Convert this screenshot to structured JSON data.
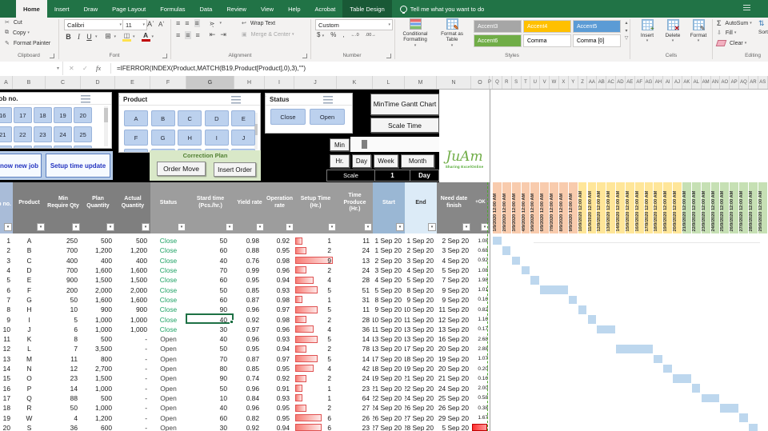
{
  "colors": {
    "excel_green": "#217346",
    "slicer_blue": "#bcd1ee",
    "gantt_bar": "#bdd7ee",
    "date_early": "#f8cbad",
    "date_mid": "#ffe699",
    "date_late": "#c6e0b4",
    "status_close_green": "#21a366",
    "databar_red": "#e05252",
    "header_gray": "#7f7f7f"
  },
  "ribbon": {
    "tabs": [
      {
        "label": "Home",
        "state": "active"
      },
      {
        "label": "Insert"
      },
      {
        "label": "Draw"
      },
      {
        "label": "Page Layout"
      },
      {
        "label": "Formulas"
      },
      {
        "label": "Data"
      },
      {
        "label": "Review"
      },
      {
        "label": "View"
      },
      {
        "label": "Help"
      },
      {
        "label": "Acrobat"
      },
      {
        "label": "Table Design",
        "state": "contextual"
      }
    ],
    "tell_me": "Tell me what you want to do",
    "clipboard": {
      "label": "Clipboard",
      "items": [
        "Cut",
        "Copy",
        "Format Painter"
      ]
    },
    "font": {
      "label": "Font",
      "font_name": "Calibri",
      "font_size": "11"
    },
    "alignment": {
      "label": "Alignment",
      "wrap_text": "Wrap Text",
      "merge_center": "Merge & Center"
    },
    "number": {
      "label": "Number",
      "format": "Custom"
    },
    "styles": {
      "label": "Styles",
      "cond_fmt": "Conditional Formatting",
      "fmt_table": "Format as Table",
      "gallery": [
        {
          "label": "Accent3",
          "bg": "#a6a6a6",
          "fg": "#ffffff"
        },
        {
          "label": "Accent4",
          "bg": "#ffc000",
          "fg": "#ffffff"
        },
        {
          "label": "Accent5",
          "bg": "#5b9bd5",
          "fg": "#ffffff"
        },
        {
          "label": "Accent6",
          "bg": "#70ad47",
          "fg": "#ffffff"
        },
        {
          "label": "Comma",
          "bg": "#ffffff",
          "fg": "#000000"
        },
        {
          "label": "Comma [0]",
          "bg": "#ffffff",
          "fg": "#000000"
        }
      ]
    },
    "cells": {
      "label": "Cells",
      "items": [
        "Insert",
        "Delete",
        "Format"
      ]
    },
    "editing": {
      "label": "Editing",
      "items": [
        "AutoSum",
        "Fill",
        "Clear"
      ],
      "sort_filter": "Sort & Filter"
    }
  },
  "formula_bar": {
    "formula": "=IFERROR(INDEX(Product,MATCH(B19,Product[Product],0),3),\"\")"
  },
  "column_letters": {
    "table": [
      "A",
      "B",
      "C",
      "D",
      "E",
      "F",
      "G",
      "H",
      "I",
      "J",
      "K",
      "L",
      "M",
      "N",
      "O"
    ],
    "selected": "G",
    "gantt": [
      "P",
      "Q",
      "R",
      "S",
      "T",
      "U",
      "V",
      "W",
      "X",
      "Y",
      "Z",
      "AA",
      "AB",
      "AC",
      "AD",
      "AE",
      "AF",
      "AG",
      "AH",
      "AI",
      "AJ",
      "AK",
      "AL",
      "AM",
      "AN",
      "AO",
      "AP",
      "AQ",
      "AR",
      "AS"
    ]
  },
  "slicers": {
    "job_no": {
      "title": "Job no.",
      "buttons": [
        "16",
        "17",
        "18",
        "19",
        "20",
        "21",
        "22",
        "23",
        "24",
        "25"
      ]
    },
    "product": {
      "title": "Product",
      "buttons": [
        "A",
        "B",
        "C",
        "D",
        "E",
        "F",
        "G",
        "H",
        "I",
        "J"
      ]
    },
    "status": {
      "title": "Status",
      "buttons": [
        "Close",
        "Open"
      ]
    }
  },
  "action_buttons": {
    "new_job": "now new job",
    "setup_time": "Setup time update"
  },
  "correction_plan": {
    "title": "Correction Plan",
    "buttons": [
      "Order Move",
      "Insert Order"
    ]
  },
  "gantt_controls": {
    "title_button": "MinTime Gantt Chart",
    "scale_time": "Scale Time",
    "min": "Min",
    "periods": [
      "Hr.",
      "Day",
      "Week",
      "Month"
    ],
    "scale_label": "Scale",
    "scale_value": "1",
    "scale_unit": "Day"
  },
  "logo": {
    "text": "JuAm",
    "subtext": "Sharing ExcelOnline"
  },
  "table": {
    "headers": [
      "Job no.",
      "Product",
      "Min Require Qty",
      "Plan Quantity",
      "Actual Quantity",
      "Status",
      "Stard time (Pcs./hr.)",
      "Yield rate",
      "Operation rate",
      "Setup Time (Hr.)",
      "Time Produce (Hr.)",
      "Start",
      "End",
      "Need date finish",
      "+OK"
    ],
    "rows": [
      [
        "1",
        "A",
        "250",
        "500",
        "500",
        "Close",
        "50",
        "0.98",
        "0.92",
        "1",
        "11",
        "1 Sep 20",
        "1 Sep 20",
        "2 Sep 20",
        "1.08"
      ],
      [
        "2",
        "B",
        "700",
        "1,200",
        "1,200",
        "Close",
        "60",
        "0.88",
        "0.95",
        "2",
        "24",
        "1 Sep 20",
        "2 Sep 20",
        "3 Sep 20",
        "0.68"
      ],
      [
        "3",
        "C",
        "400",
        "400",
        "400",
        "Close",
        "40",
        "0.76",
        "0.98",
        "9",
        "13",
        "2 Sep 20",
        "3 Sep 20",
        "4 Sep 20",
        "0.92"
      ],
      [
        "4",
        "D",
        "700",
        "1,600",
        "1,600",
        "Close",
        "70",
        "0.99",
        "0.96",
        "2",
        "24",
        "3 Sep 20",
        "4 Sep 20",
        "5 Sep 20",
        "1.08"
      ],
      [
        "5",
        "E",
        "900",
        "1,500",
        "1,500",
        "Close",
        "60",
        "0.95",
        "0.94",
        "4",
        "28",
        "4 Sep 20",
        "5 Sep 20",
        "7 Sep 20",
        "1.98"
      ],
      [
        "6",
        "F",
        "200",
        "2,000",
        "2,000",
        "Close",
        "50",
        "0.85",
        "0.93",
        "5",
        "51",
        "5 Sep 20",
        "8 Sep 20",
        "9 Sep 20",
        "1.01"
      ],
      [
        "7",
        "G",
        "50",
        "1,600",
        "1,600",
        "Close",
        "60",
        "0.87",
        "0.98",
        "1",
        "31",
        "8 Sep 20",
        "9 Sep 20",
        "9 Sep 20",
        "0.16"
      ],
      [
        "8",
        "H",
        "10",
        "900",
        "900",
        "Close",
        "90",
        "0.96",
        "0.97",
        "5",
        "11",
        "9 Sep 20",
        "10 Sep 20",
        "11 Sep 20",
        "0.82"
      ],
      [
        "9",
        "I",
        "5",
        "1,000",
        "1,000",
        "Close",
        "40",
        "0.92",
        "0.98",
        "2",
        "28",
        "10 Sep 20",
        "11 Sep 20",
        "12 Sep 20",
        "1.16"
      ],
      [
        "10",
        "J",
        "6",
        "1,000",
        "1,000",
        "Close",
        "30",
        "0.97",
        "0.96",
        "4",
        "36",
        "11 Sep 20",
        "13 Sep 20",
        "13 Sep 20",
        "0.17"
      ],
      [
        "11",
        "K",
        "8",
        "500",
        "-",
        "Open",
        "40",
        "0.96",
        "0.93",
        "5",
        "14",
        "13 Sep 20",
        "13 Sep 20",
        "16 Sep 20",
        "2.68"
      ],
      [
        "12",
        "L",
        "7",
        "3,500",
        "-",
        "Open",
        "50",
        "0.95",
        "0.94",
        "2",
        "78",
        "13 Sep 20",
        "17 Sep 20",
        "20 Sep 20",
        "2.88"
      ],
      [
        "13",
        "M",
        "11",
        "800",
        "-",
        "Open",
        "70",
        "0.87",
        "0.97",
        "5",
        "14",
        "17 Sep 20",
        "18 Sep 20",
        "19 Sep 20",
        "1.07"
      ],
      [
        "14",
        "N",
        "12",
        "2,700",
        "-",
        "Open",
        "80",
        "0.85",
        "0.95",
        "4",
        "42",
        "18 Sep 20",
        "19 Sep 20",
        "20 Sep 20",
        "0.20"
      ],
      [
        "15",
        "O",
        "23",
        "1,500",
        "-",
        "Open",
        "90",
        "0.74",
        "0.92",
        "2",
        "24",
        "19 Sep 20",
        "21 Sep 20",
        "21 Sep 20",
        "0.16"
      ],
      [
        "16",
        "P",
        "14",
        "1,000",
        "-",
        "Open",
        "50",
        "0.96",
        "0.91",
        "1",
        "23",
        "21 Sep 20",
        "22 Sep 20",
        "24 Sep 20",
        "2.00"
      ],
      [
        "17",
        "Q",
        "88",
        "500",
        "-",
        "Open",
        "10",
        "0.84",
        "0.93",
        "1",
        "64",
        "22 Sep 20",
        "24 Sep 20",
        "25 Sep 20",
        "0.58"
      ],
      [
        "18",
        "R",
        "50",
        "1,000",
        "-",
        "Open",
        "40",
        "0.96",
        "0.95",
        "2",
        "27",
        "24 Sep 20",
        "26 Sep 20",
        "26 Sep 20",
        "0.38"
      ],
      [
        "19",
        "W",
        "4",
        "1,200",
        "-",
        "Open",
        "60",
        "0.82",
        "0.95",
        "6",
        "26",
        "26 Sep 20",
        "27 Sep 20",
        "29 Sep 20",
        "1.67"
      ],
      [
        "20",
        "S",
        "36",
        "600",
        "-",
        "Open",
        "30",
        "0.92",
        "0.94",
        "6",
        "23",
        "27 Sep 20",
        "28 Sep 20",
        "5 Sep 20",
        ""
      ]
    ],
    "ok_alert_row": 19
  },
  "selection": {
    "column_letter": "G",
    "row_index": 8,
    "column_index": 6
  },
  "gantt": {
    "dates": [
      "1/9/2020 12:00 AM",
      "2/9/2020 12:00 AM",
      "3/9/2020 12:00 AM",
      "4/9/2020 12:00 AM",
      "5/9/2020 12:00 AM",
      "6/9/2020 12:00 AM",
      "7/9/2020 12:00 AM",
      "8/9/2020 12:00 AM",
      "9/9/2020 12:00 AM",
      "10/9/2020 12:00 AM",
      "11/9/2020 12:00 AM",
      "12/9/2020 12:00 AM",
      "13/9/2020 12:00 AM",
      "14/9/2020 12:00 AM",
      "15/9/2020 12:00 AM",
      "16/9/2020 12:00 AM",
      "17/9/2020 12:00 AM",
      "18/9/2020 12:00 AM",
      "19/9/2020 12:00 AM",
      "20/9/2020 12:00 AM",
      "21/9/2020 12:00 AM",
      "22/9/2020 12:00 AM",
      "23/9/2020 12:00 AM",
      "24/9/2020 12:00 AM",
      "25/9/2020 12:00 AM",
      "26/9/2020 12:00 AM",
      "27/9/2020 12:00 AM",
      "28/9/2020 12:00 AM",
      "29/9/2020 12:00 AM"
    ],
    "bars": [
      [
        1,
        1
      ],
      [
        2,
        2
      ],
      [
        3,
        3
      ],
      [
        4,
        4
      ],
      [
        5,
        5
      ],
      [
        6,
        8
      ],
      [
        9,
        9
      ],
      [
        10,
        10
      ],
      [
        11,
        11
      ],
      [
        12,
        13
      ],
      null,
      [
        14,
        17
      ],
      [
        18,
        18
      ],
      [
        19,
        19
      ],
      [
        20,
        21
      ],
      [
        22,
        22
      ],
      [
        23,
        24
      ],
      [
        25,
        26
      ],
      [
        27,
        27
      ],
      [
        28,
        28
      ]
    ]
  }
}
